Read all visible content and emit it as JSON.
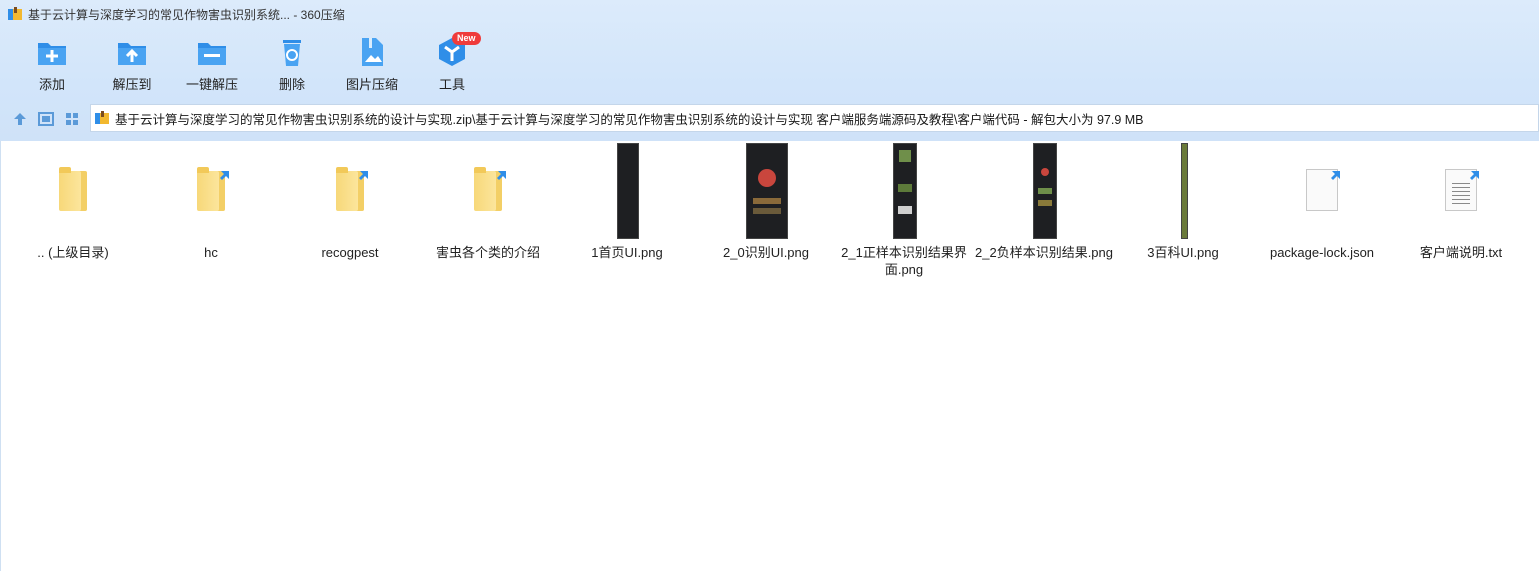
{
  "window": {
    "title": "基于云计算与深度学习的常见作物害虫识别系统... - 360压缩"
  },
  "toolbar": {
    "items": [
      {
        "label": "添加",
        "icon": "add-icon"
      },
      {
        "label": "解压到",
        "icon": "extract-to-icon"
      },
      {
        "label": "一键解压",
        "icon": "one-click-extract-icon"
      },
      {
        "label": "删除",
        "icon": "delete-icon"
      },
      {
        "label": "图片压缩",
        "icon": "image-compress-icon"
      },
      {
        "label": "工具",
        "icon": "tools-icon",
        "badge": "New"
      }
    ]
  },
  "nav": {
    "address": "基于云计算与深度学习的常见作物害虫识别系统的设计与实现.zip\\基于云计算与深度学习的常见作物害虫识别系统的设计与实现 客户端服务端源码及教程\\客户端代码 - 解包大小为 97.9 MB"
  },
  "files": [
    {
      "name": ".. (上级目录)",
      "type": "parent-folder"
    },
    {
      "name": "hc",
      "type": "folder"
    },
    {
      "name": "recogpest",
      "type": "folder"
    },
    {
      "name": "害虫各个类的介绍",
      "type": "folder"
    },
    {
      "name": "1首页UI.png",
      "type": "image"
    },
    {
      "name": "2_0识别UI.png",
      "type": "image"
    },
    {
      "name": "2_1正样本识别结果界面.png",
      "type": "image"
    },
    {
      "name": "2_2负样本识别结果.png",
      "type": "image"
    },
    {
      "name": "3百科UI.png",
      "type": "image"
    },
    {
      "name": "package-lock.json",
      "type": "json"
    },
    {
      "name": "客户端说明.txt",
      "type": "text"
    }
  ],
  "colors": {
    "accent": "#2f8ee8",
    "badge": "#ef3b3b",
    "folder": "#f7d879",
    "chrome": "#d2e5fa"
  }
}
